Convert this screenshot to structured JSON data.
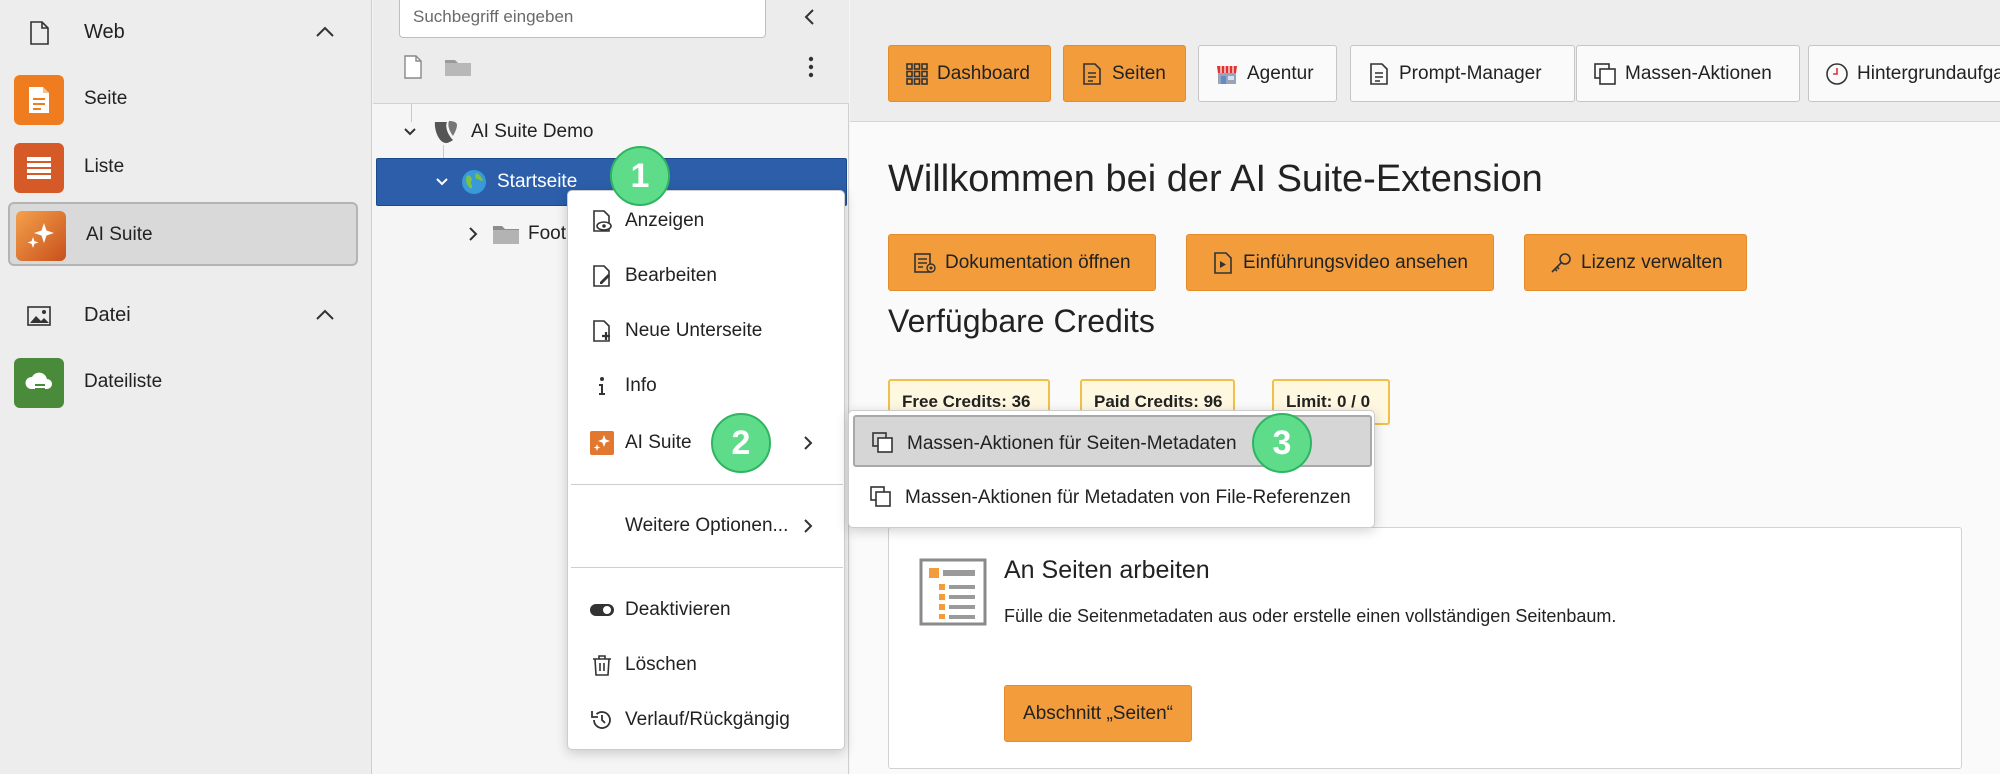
{
  "module_menu": {
    "groups": [
      {
        "label": "Web",
        "icon": "document-icon"
      },
      {
        "label": "Datei",
        "icon": "image-icon"
      }
    ],
    "items": [
      {
        "label": "Seite",
        "icon": "page-module-icon",
        "color": "#f07c20"
      },
      {
        "label": "Liste",
        "icon": "list-module-icon",
        "color": "#d65a28"
      },
      {
        "label": "AI Suite",
        "icon": "ai-suite-icon",
        "color": "#e37a2d",
        "active": true
      },
      {
        "label": "Dateiliste",
        "icon": "filelist-module-icon",
        "color": "#4a8a3b"
      }
    ]
  },
  "page_tree": {
    "search_placeholder": "Suchbegriff eingeben",
    "root_label": "AI Suite Demo",
    "selected_label": "Startseite",
    "child_label": "Foot"
  },
  "context_menu": {
    "items": [
      {
        "label": "Anzeigen",
        "icon": "view-page-icon"
      },
      {
        "label": "Bearbeiten",
        "icon": "edit-page-icon"
      },
      {
        "label": "Neue Unterseite",
        "icon": "new-page-icon"
      },
      {
        "label": "Info",
        "icon": "info-icon"
      },
      {
        "label": "AI Suite",
        "icon": "ai-suite-icon"
      },
      {
        "label": "Weitere Optionen...",
        "icon": ""
      },
      {
        "label": "Deaktivieren",
        "icon": "toggle-icon"
      },
      {
        "label": "Löschen",
        "icon": "trash-icon"
      },
      {
        "label": "Verlauf/Rückgängig",
        "icon": "history-icon"
      }
    ]
  },
  "submenu": {
    "items": [
      {
        "label": "Massen-Aktionen für Seiten-Metadaten",
        "icon": "copy-icon"
      },
      {
        "label": "Massen-Aktionen für Metadaten von File-Referenzen",
        "icon": "copy-icon"
      }
    ]
  },
  "main": {
    "nav": [
      {
        "label": "Dashboard",
        "icon": "grid-icon",
        "style": "orange"
      },
      {
        "label": "Seiten",
        "icon": "document-icon",
        "style": "orange"
      },
      {
        "label": "Agentur",
        "icon": "shop-icon",
        "style": "white"
      },
      {
        "label": "Prompt-Manager",
        "icon": "document-icon",
        "style": "white"
      },
      {
        "label": "Massen-Aktionen",
        "icon": "copy-icon",
        "style": "white"
      },
      {
        "label": "Hintergrundaufgaben",
        "icon": "clock-icon",
        "style": "white"
      }
    ],
    "title": "Willkommen bei der AI Suite-Extension",
    "actions": [
      {
        "label": "Dokumentation öffnen",
        "icon": "documentation-icon"
      },
      {
        "label": "Einführungsvideo ansehen",
        "icon": "video-icon"
      },
      {
        "label": "Lizenz verwalten",
        "icon": "key-icon"
      }
    ],
    "credits_title": "Verfügbare Credits",
    "credits": [
      {
        "label": "Free Credits: 36"
      },
      {
        "label": "Paid Credits: 96"
      },
      {
        "label": "Limit: 0 / 0"
      }
    ],
    "card": {
      "title": "An Seiten arbeiten",
      "text": "Fülle die Seitenmetadaten aus oder erstelle einen vollständigen Seitenbaum.",
      "button": "Abschnitt „Seiten“"
    }
  },
  "steps": [
    "1",
    "2",
    "3"
  ],
  "colors": {
    "accent": "#f39c3c",
    "selected": "#2c5eaa",
    "step": "#5fdc8a"
  }
}
